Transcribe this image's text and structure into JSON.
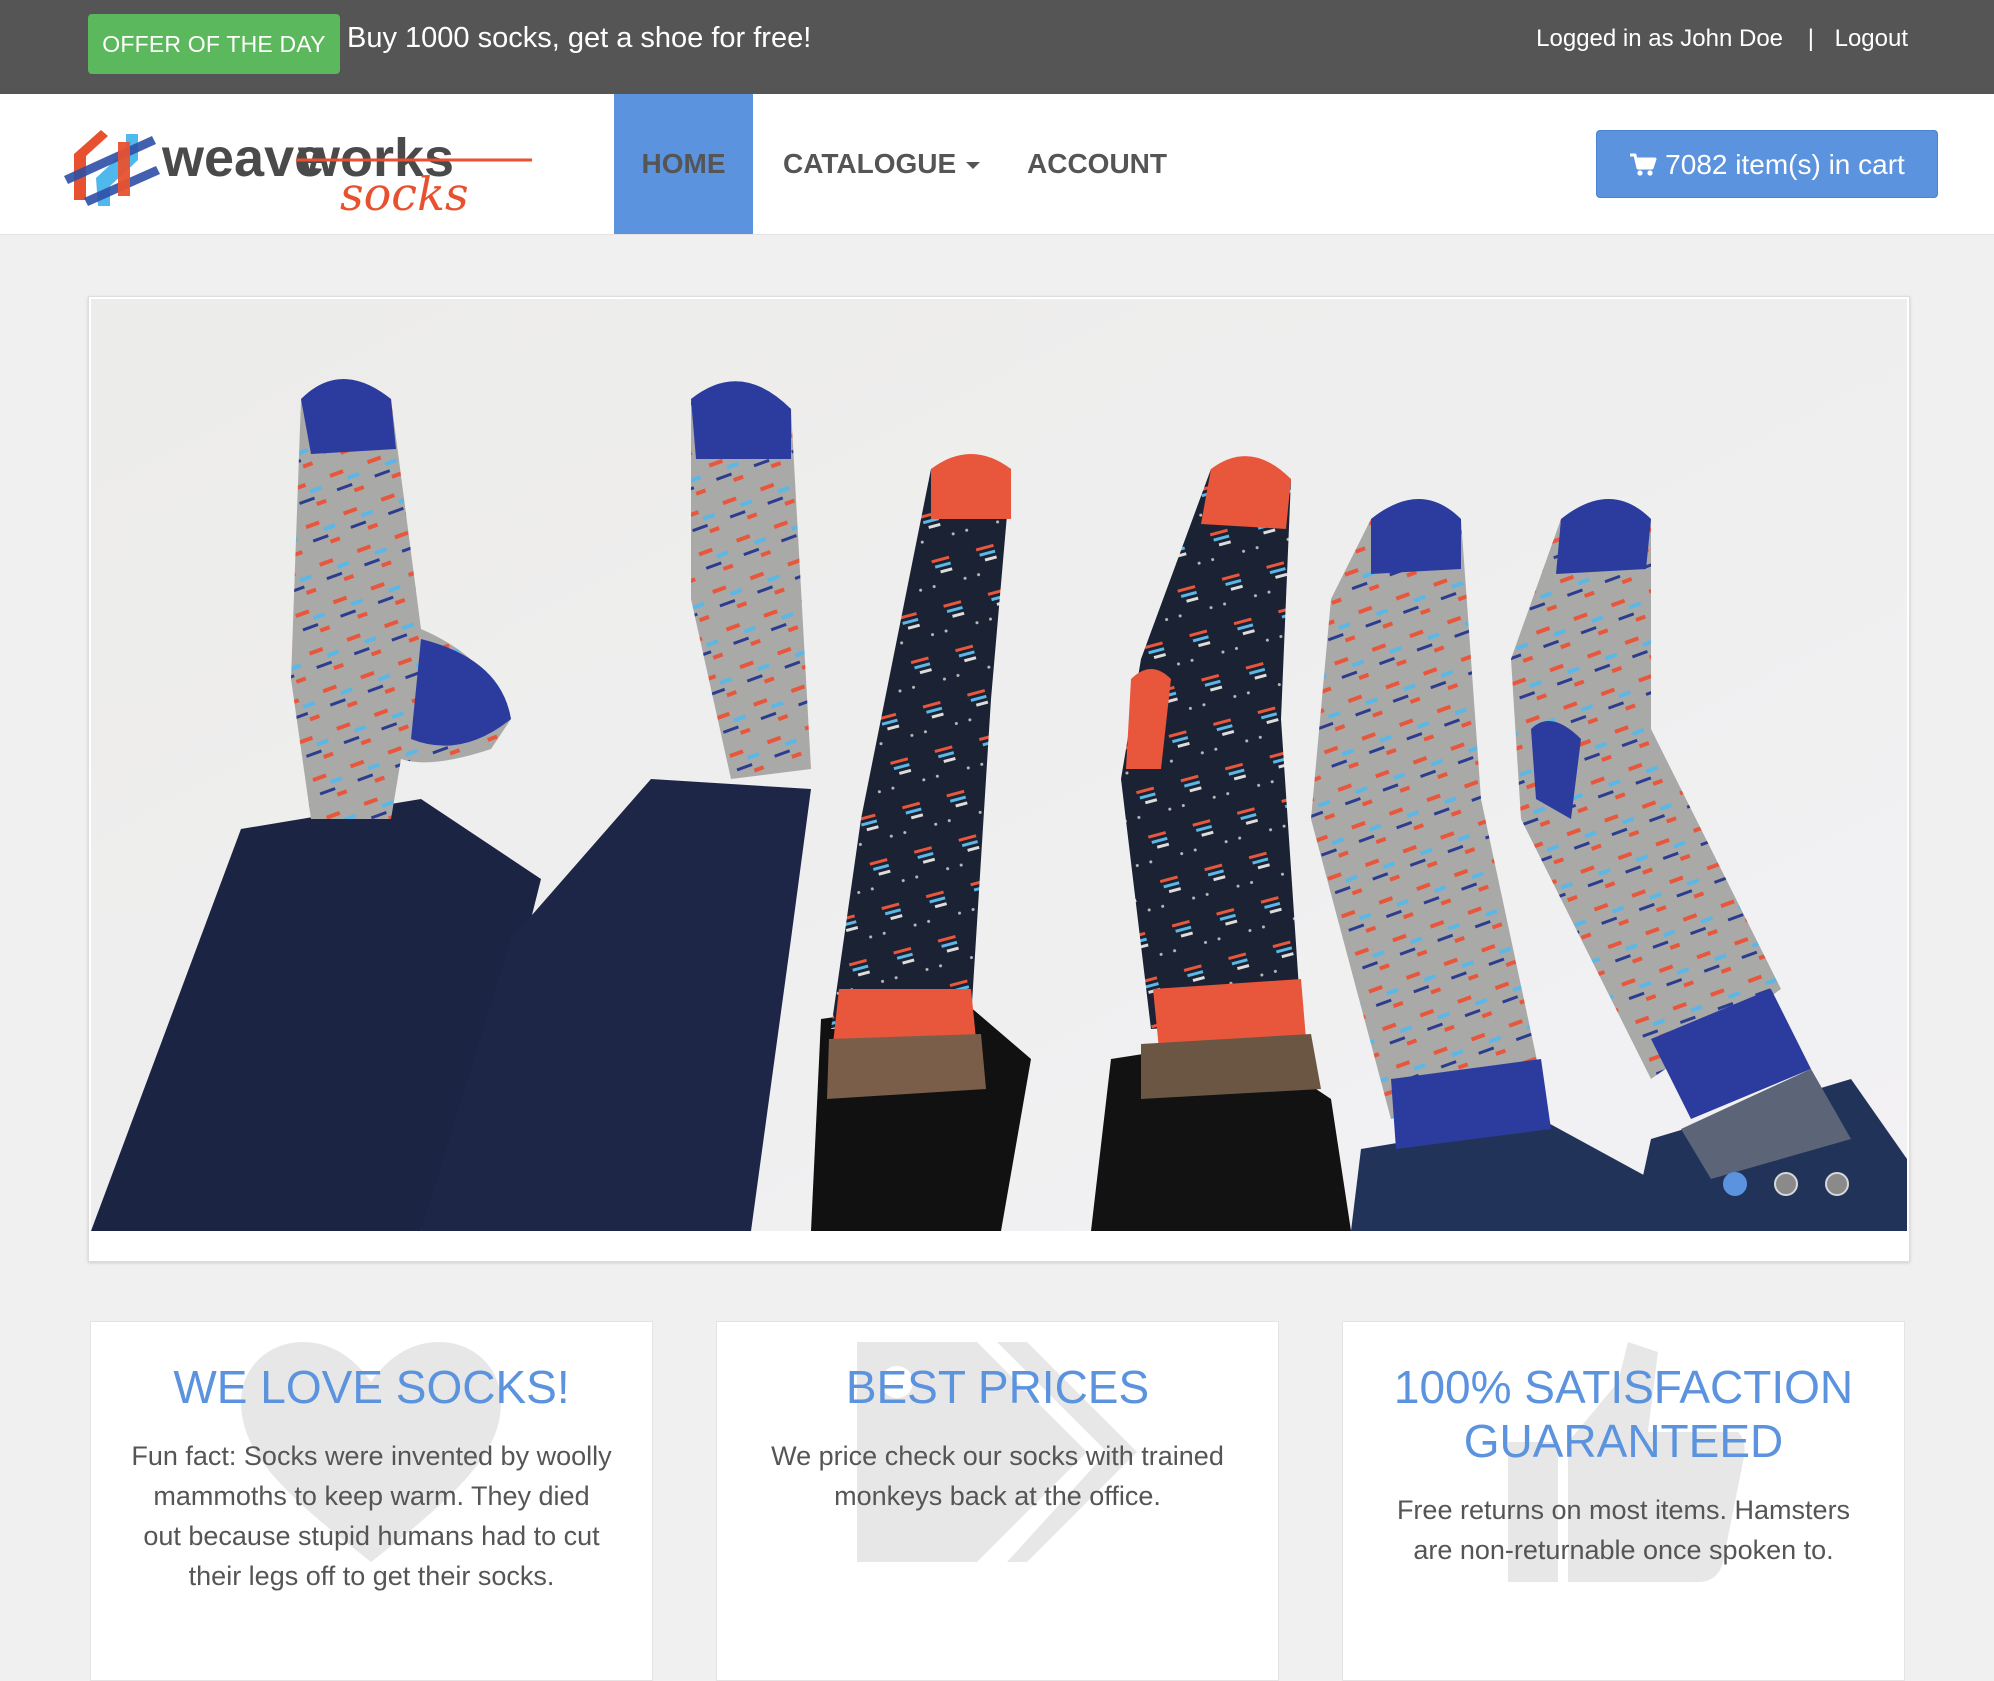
{
  "topbar": {
    "offer_badge": "OFFER OF THE DAY",
    "offer_text": "Buy 1000 socks, get a shoe for free!",
    "logged_in_text": "Logged in as John Doe",
    "separator": "|",
    "logout_label": "Logout"
  },
  "logo": {
    "word1": "weave",
    "word2": "works",
    "word3": "socks"
  },
  "nav": {
    "items": [
      {
        "label": "Home",
        "active": true
      },
      {
        "label": "Catalogue",
        "has_dropdown": true
      },
      {
        "label": "Account"
      }
    ]
  },
  "cart": {
    "label": "7082 item(s) in cart",
    "icon": "shopping-cart-icon"
  },
  "carousel": {
    "slide_count": 3,
    "active_index": 0,
    "image_description_icon": "socks-photo"
  },
  "features": [
    {
      "title": "WE LOVE SOCKS!",
      "text": "Fun fact: Socks were invented by woolly mammoths to keep warm. They died out because stupid humans had to cut their legs off to get their socks.",
      "icon": "heart-icon"
    },
    {
      "title": "BEST PRICES",
      "text": "We price check our socks with trained monkeys back at the office.",
      "icon": "tags-icon"
    },
    {
      "title": "100% SATISFACTION GUARANTEED",
      "text": "Free returns on most items. Hamsters are non-returnable once spoken to.",
      "icon": "thumbs-up-icon"
    }
  ],
  "colors": {
    "accent": "#5b93de",
    "offer_green": "#5cb85c",
    "topbar": "#555555",
    "logo_red": "#e8512f",
    "logo_blue": "#4fb8ec"
  }
}
